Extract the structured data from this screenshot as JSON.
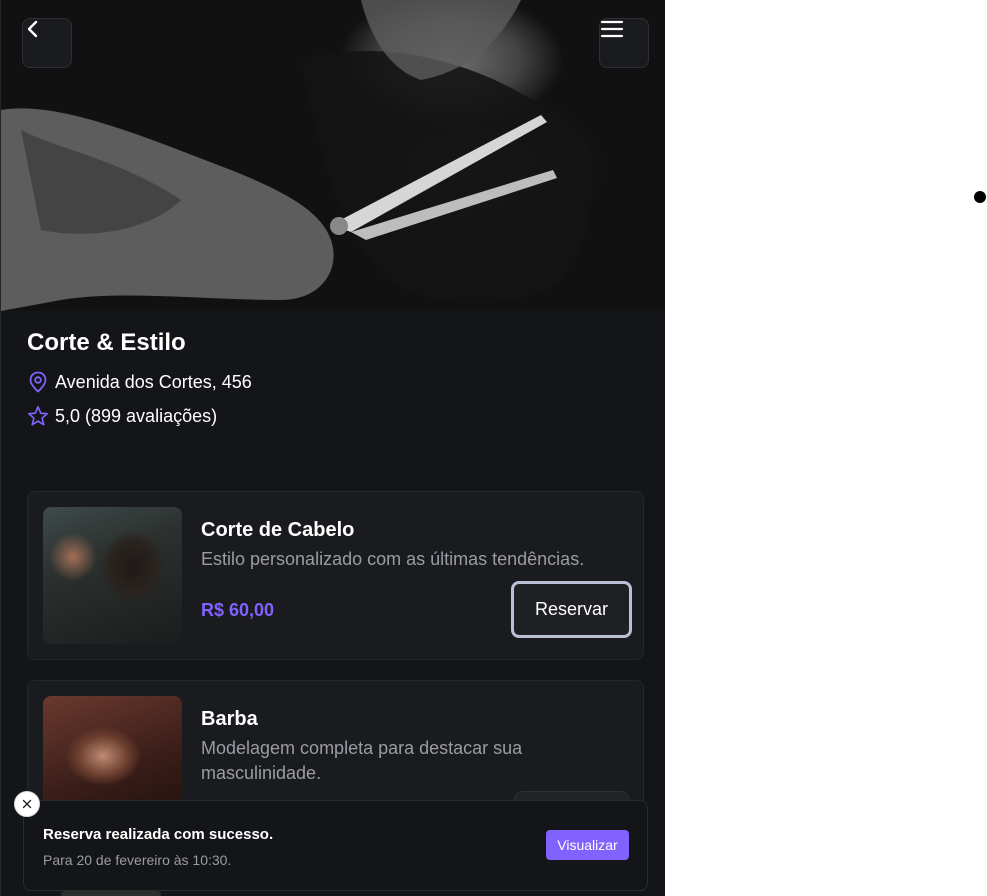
{
  "shop": {
    "name": "Corte & Estilo",
    "address": "Avenida dos Cortes, 456",
    "rating": "5,0 (899 avaliações)"
  },
  "header": {
    "back_icon": "chevron-left-icon",
    "menu_icon": "menu-icon"
  },
  "services": [
    {
      "name": "Corte de Cabelo",
      "description": "Estilo personalizado com as últimas tendências.",
      "price": "R$ 60,00",
      "button": "Reservar"
    },
    {
      "name": "Barba",
      "description": "Modelagem completa para destacar sua masculinidade."
    }
  ],
  "toast": {
    "title": "Reserva realizada com sucesso.",
    "description": "Para 20 de fevereiro às 10:30.",
    "action": "Visualizar"
  },
  "colors": {
    "accent": "#8162ff",
    "background": "#141518",
    "card": "#1a1b1f",
    "muted_text": "#9b9ca3"
  }
}
